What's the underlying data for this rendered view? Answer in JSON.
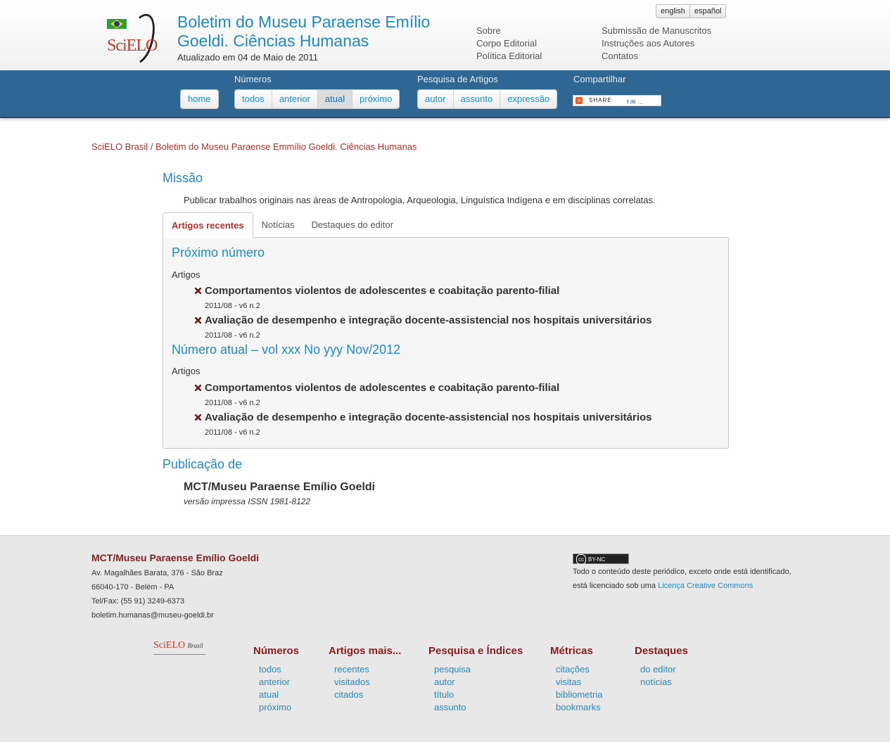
{
  "header": {
    "logo_text": "SciELO",
    "journal_title": "Boletim do Museu Paraense Emílio Goeldi. Ciências Humanas",
    "updated": "Atualizado em 04 de Maio de 2011",
    "languages": [
      "english",
      "español"
    ],
    "links_col1": [
      "Sobre",
      "Corpo Editorial",
      "Política Editorial"
    ],
    "links_col2": [
      "Submissão de Manuscritos",
      "Instruções aos Autores",
      "Contatos"
    ]
  },
  "nav": {
    "home": "home",
    "numeros_label": "Números",
    "numeros": [
      "todos",
      "anterior",
      "atual",
      "próximo"
    ],
    "pesquisa_label": "Pesquisa de Artigos",
    "pesquisa": [
      "autor",
      "assunto",
      "expressão"
    ],
    "compartilhar_label": "Compartilhar",
    "share_text": "SHARE"
  },
  "breadcrumb": {
    "root": "SciELO Brasil",
    "sep": " / ",
    "current": "Boletim do Museu Paraense Emmílio Goeldi. Ciências Humanas"
  },
  "mission": {
    "title": "Missão",
    "text": "Publicar trabalhos originais nas áreas de Antropologia, Arqueologia, Linguística Indígena e em disciplinas correlatas."
  },
  "tabs": [
    "Artigos recentes",
    "Notícias",
    "Destaques do editor"
  ],
  "recent": {
    "next_title": "Próximo número",
    "current_title": "Número atual – vol xxx No yyy Nov/2012",
    "artigos_label": "Artigos",
    "next_articles": [
      {
        "title": "Comportamentos violentos de adolescentes e coabitação parento-filial",
        "meta": "2011/08 - v6 n.2"
      },
      {
        "title": "Avaliação de desempenho e integração docente-assistencial nos hospitais universitários",
        "meta": "2011/08 - v6 n.2"
      }
    ],
    "current_articles": [
      {
        "title": "Comportamentos violentos de adolescentes e coabitação parento-filial",
        "meta": "2011/08 - v6 n.2"
      },
      {
        "title": "Avaliação de desempenho e integração docente-assistencial nos hospitais universitários",
        "meta": "2011/08 - v6 n.2"
      }
    ]
  },
  "publication": {
    "title": "Publicação de",
    "name": "MCT/Museu Paraense Emílio Goeldi",
    "issn": "versão impressa ISSN 1981-8122"
  },
  "footer": {
    "org": "MCT/Museu Paraense Emílio Goeldi",
    "address": "Av. Magalhães Barata, 376 - São Braz",
    "cep": "66040-170 - Belém - PA",
    "phone": "Tel/Fax: (55 91) 3249-6373",
    "email": "boletim.humanas@museu-goeldi.br",
    "cc_badge": "BY-NC",
    "license_line1": "Todo o conteúdo deste periódico, exceto onde está identificado,",
    "license_line2_prefix": "está licenciado sob uma ",
    "license_link": "Licença Creative Commons",
    "logo_text": "SciELO",
    "logo_sub": "Brasil",
    "columns": [
      {
        "title": "Números",
        "links": [
          "todos",
          "anterior",
          "atual",
          "próximo"
        ]
      },
      {
        "title": "Artigos mais...",
        "links": [
          "recentes",
          "visitados",
          "citados"
        ]
      },
      {
        "title": "Pesquisa e Índices",
        "links": [
          "pesquisa",
          "autor",
          "título",
          "assunto"
        ]
      },
      {
        "title": "Métricas",
        "links": [
          "citações",
          "visitas",
          "bibliometria",
          "bookmarks"
        ]
      },
      {
        "title": "Destaques",
        "links": [
          "do editor",
          "notícias"
        ]
      }
    ]
  }
}
